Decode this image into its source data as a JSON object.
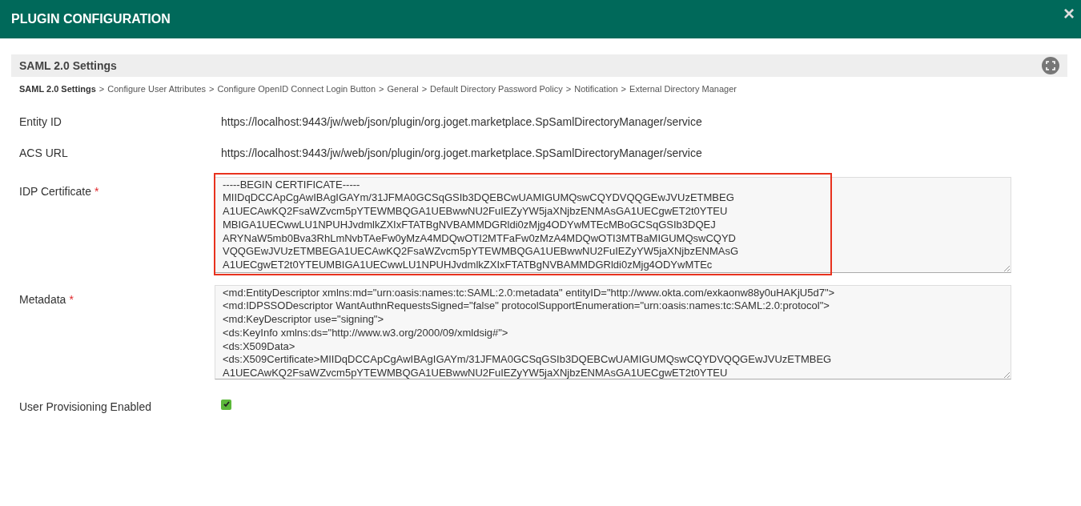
{
  "header": {
    "title": "PLUGIN CONFIGURATION",
    "close": "×"
  },
  "section": {
    "title": "SAML 2.0 Settings"
  },
  "breadcrumb": [
    {
      "label": "SAML 2.0 Settings",
      "selected": true
    },
    {
      "label": "Configure User Attributes",
      "selected": false,
      "prefix": ">"
    },
    {
      "label": "Configure OpenID Connect Login Button",
      "selected": false,
      "prefix": ">"
    },
    {
      "label": "General",
      "selected": false,
      "prefix": ">"
    },
    {
      "label": "Default Directory Password Policy",
      "selected": false,
      "prefix": ">"
    },
    {
      "label": "Notification",
      "selected": false,
      "prefix": ">"
    },
    {
      "label": "External Directory Manager",
      "selected": false,
      "prefix": ">"
    }
  ],
  "fields": [
    {
      "kind": "text",
      "label": "Entity ID",
      "value": "https://localhost:9443/jw/web/json/plugin/org.joget.marketplace.SpSamlDirectoryManager/service"
    },
    {
      "kind": "text",
      "label": "ACS URL",
      "value": "https://localhost:9443/jw/web/json/plugin/org.joget.marketplace.SpSamlDirectoryManager/service"
    },
    {
      "kind": "textarea",
      "label": "IDP Certificate",
      "required_mark": "*",
      "highlighted": true,
      "lines": [
        "-----BEGIN CERTIFICATE-----",
        "MIIDqDCCApCgAwIBAgIGAYm/31JFMA0GCSqGSIb3DQEBCwUAMIGUMQswCQYDVQQGEwJVUzETMBEG",
        "A1UECAwKQ2FsaWZvcm5pYTEWMBQGA1UEBwwNU2FuIEZyYW5jaXNjbzENMAsGA1UECgwET2t0YTEU",
        "MBIGA1UECwwLU1NPUHJvdmlkZXIxFTATBgNVBAMMDGRldi0zMjg4ODYwMTEcMBoGCSqGSIb3DQEJ",
        "ARYNaW5mb0Bva3RhLmNvbTAeFw0yMzA4MDQwOTI2MTFaFw0zMzA4MDQwOTI3MTBaMIGUMQswCQYD",
        "VQQGEwJVUzETMBEGA1UECAwKQ2FsaWZvcm5pYTEWMBQGA1UEBwwNU2FuIEZyYW5jaXNjbzENMAsG",
        "A1UECgwET2t0YTEUMBIGA1UECwwLU1NPUHJvdmlkZXIxFTATBgNVBAMMDGRldi0zMjg4ODYwMTEc"
      ]
    },
    {
      "kind": "textarea",
      "label": "Metadata",
      "required_mark": "*",
      "highlighted": false,
      "lines": [
        "<md:EntityDescriptor xmlns:md=\"urn:oasis:names:tc:SAML:2.0:metadata\" entityID=\"http://www.okta.com/exkaonw88y0uHAKjU5d7\">",
        "<md:IDPSSODescriptor WantAuthnRequestsSigned=\"false\" protocolSupportEnumeration=\"urn:oasis:names:tc:SAML:2.0:protocol\">",
        "<md:KeyDescriptor use=\"signing\">",
        "<ds:KeyInfo xmlns:ds=\"http://www.w3.org/2000/09/xmldsig#\">",
        "<ds:X509Data>",
        "<ds:X509Certificate>MIIDqDCCApCgAwIBAgIGAYm/31JFMA0GCSqGSIb3DQEBCwUAMIGUMQswCQYDVQQGEwJVUzETMBEG",
        "A1UECAwKQ2FsaWZvcm5pYTEWMBQGA1UEBwwNU2FuIEZyYW5jaXNjbzENMAsGA1UECgwET2t0YTEU"
      ]
    },
    {
      "kind": "checkbox",
      "label": "User Provisioning Enabled",
      "checked": true
    }
  ]
}
